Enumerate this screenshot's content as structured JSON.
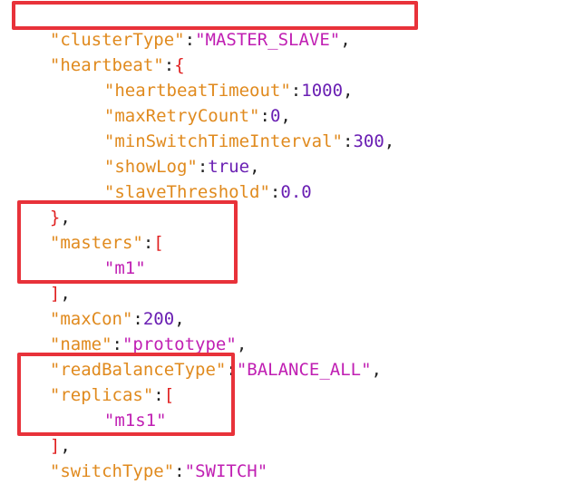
{
  "lines": {
    "clusterType": {
      "key": "\"clusterType\"",
      "sep": ":",
      "value": "\"MASTER_SLAVE\"",
      "end": ","
    },
    "heartbeat": {
      "key": "\"heartbeat\"",
      "sep": ":",
      "open": "{"
    },
    "heartbeatTimeout": {
      "key": "\"heartbeatTimeout\"",
      "sep": ":",
      "value": "1000",
      "end": ","
    },
    "maxRetryCount": {
      "key": "\"maxRetryCount\"",
      "sep": ":",
      "value": "0",
      "end": ","
    },
    "minSwitchTimeInterval": {
      "key": "\"minSwitchTimeInterval\"",
      "sep": ":",
      "value": "300",
      "end": ","
    },
    "showLog": {
      "key": "\"showLog\"",
      "sep": ":",
      "value": "true",
      "end": ","
    },
    "slaveThreshold": {
      "key": "\"slaveThreshold\"",
      "sep": ":",
      "value": "0.0"
    },
    "heartbeatClose": {
      "close": "}",
      "end": ","
    },
    "masters": {
      "key": "\"masters\"",
      "sep": ":",
      "open": "["
    },
    "mastersItem": {
      "value": "\"m1\""
    },
    "mastersClose": {
      "close": "]",
      "end": ","
    },
    "maxCon": {
      "key": "\"maxCon\"",
      "sep": ":",
      "value": "200",
      "end": ","
    },
    "name": {
      "key": "\"name\"",
      "sep": ":",
      "value": "\"prototype\"",
      "end": ","
    },
    "readBalanceType": {
      "key": "\"readBalanceType\"",
      "sep": ":",
      "value": "\"BALANCE_ALL\"",
      "end": ","
    },
    "replicas": {
      "key": "\"replicas\"",
      "sep": ":",
      "open": "["
    },
    "replicasItem": {
      "value": "\"m1s1\""
    },
    "replicasClose": {
      "close": "]",
      "end": ","
    },
    "switchType": {
      "key": "\"switchType\"",
      "sep": ":",
      "value": "\"SWITCH\""
    }
  },
  "colors": {
    "key": "#e08a1e",
    "string": "#c01fb3",
    "number": "#6a1fb3",
    "bracket": "#e02020",
    "highlight_box": "#e8323a"
  }
}
